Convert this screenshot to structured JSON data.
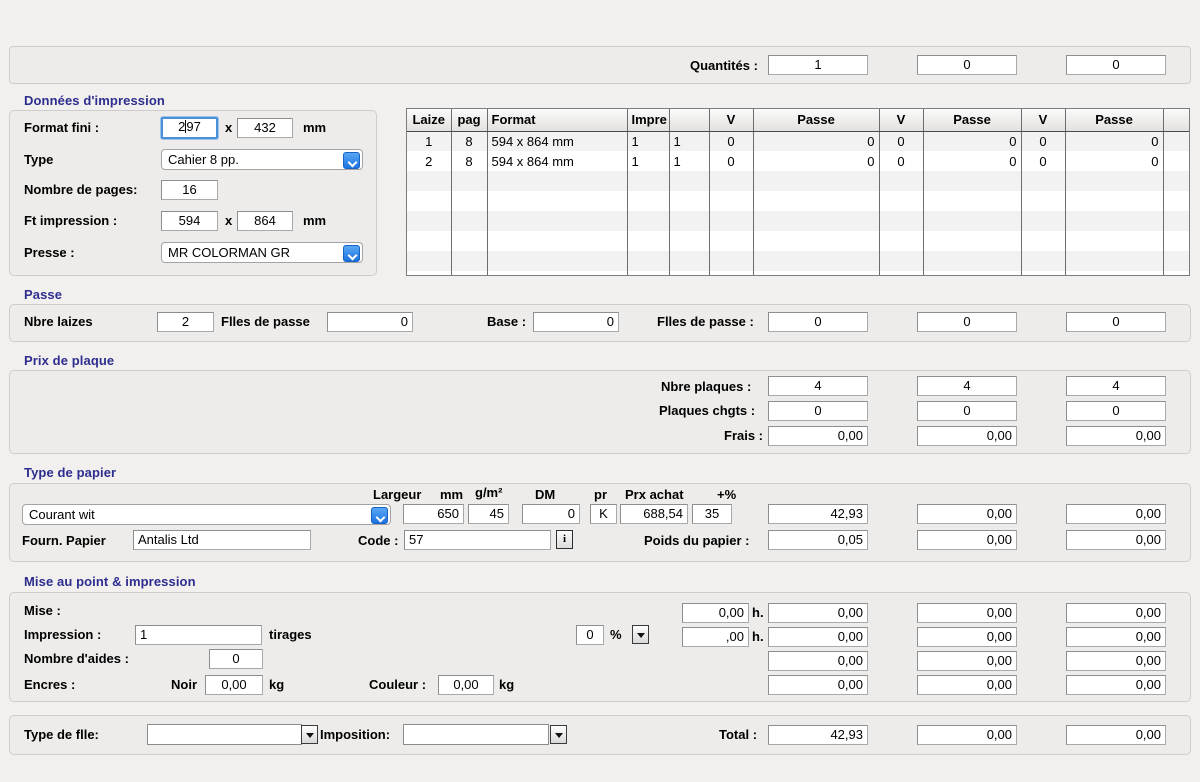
{
  "quantities": {
    "label": "Quantités :",
    "values": [
      "1",
      "0",
      "0"
    ]
  },
  "donnees": {
    "title": "Données d'impression",
    "format_fini_label": "Format fini :",
    "format_fini_w": "297",
    "format_fini_h": "432",
    "format_fini_unit": "mm",
    "type_label": "Type",
    "type_value": "Cahier   8 pp.",
    "nombre_pages_label": "Nombre de pages:",
    "nombre_pages_value": "16",
    "ft_impression_label": "Ft impression :",
    "ft_impression_w": "594",
    "ft_impression_h": "864",
    "ft_impression_unit": "mm",
    "presse_label": "Presse :",
    "presse_value": "MR COLORMAN GR",
    "x_separator": "x"
  },
  "table": {
    "headers": [
      "Laize",
      "pag",
      "Format",
      "Impre",
      "",
      "V",
      "Passe",
      "V",
      "Passe",
      "V",
      "Passe",
      ""
    ],
    "rows": [
      [
        "1",
        "8",
        "594 x 864 mm",
        "1",
        "1",
        "0",
        "0",
        "0",
        "0",
        "0",
        "0",
        ""
      ],
      [
        "2",
        "8",
        "594 x 864 mm",
        "1",
        "1",
        "0",
        "0",
        "0",
        "0",
        "0",
        "0",
        ""
      ]
    ],
    "empty_rows": 6
  },
  "passe": {
    "title": "Passe",
    "nbre_laizes_label": "Nbre laizes",
    "nbre_laizes_value": "2",
    "flles_de_passe_label": "Flles de passe",
    "flles_de_passe_value": "0",
    "base_label": "Base :",
    "base_value": "0",
    "flles_de_passe2_label": "Flles de passe :",
    "flles_de_passe2_values": [
      "0",
      "0",
      "0"
    ]
  },
  "plaque": {
    "title": "Prix de plaque",
    "nbre_plaques_label": "Nbre plaques :",
    "nbre_plaques_values": [
      "4",
      "4",
      "4"
    ],
    "plaques_chgts_label": "Plaques chgts :",
    "plaques_chgts_values": [
      "0",
      "0",
      "0"
    ],
    "frais_label": "Frais :",
    "frais_values": [
      "0,00",
      "0,00",
      "0,00"
    ]
  },
  "papier": {
    "title": "Type de papier",
    "col_largeur": "Largeur",
    "col_mm": "mm",
    "col_gm2": "g/m²",
    "col_dm": "DM",
    "col_pr": "pr",
    "col_prx_achat": "Prx achat",
    "col_pct": "+%",
    "type_value": "Courant wit",
    "largeur_value": "650",
    "gm2_value": "45",
    "dm_value": "0",
    "pr_value": "K",
    "prx_achat_value": "688,54",
    "pct_value": "35",
    "amount_values": [
      "42,93",
      "0,00",
      "0,00"
    ],
    "fourn_label": "Fourn. Papier",
    "fourn_value": "Antalis Ltd",
    "code_label": "Code :",
    "code_value": "57",
    "info_icon": "i",
    "poids_label": "Poids du papier :",
    "poids_values": [
      "0,05",
      "0,00",
      "0,00"
    ]
  },
  "mise": {
    "title": "Mise au point & impression",
    "mise_label": "Mise :",
    "impression_label": "Impression :",
    "impression_value": "1",
    "tirages_label": "tirages",
    "nombre_aides_label": "Nombre d'aides :",
    "nombre_aides_value": "0",
    "encres_label": "Encres :",
    "noir_label": "Noir",
    "noir_value": "0,00",
    "noir_unit": "kg",
    "couleur_label": "Couleur :",
    "couleur_value": "0,00",
    "couleur_unit": "kg",
    "pct_value": "0",
    "pct_sign": "%",
    "hours": [
      "0,00",
      ",00"
    ],
    "hours_unit": "h.",
    "grid": [
      [
        "0,00",
        "0,00",
        "0,00"
      ],
      [
        "0,00",
        "0,00",
        "0,00"
      ],
      [
        "0,00",
        "0,00",
        "0,00"
      ],
      [
        "0,00",
        "0,00",
        "0,00"
      ]
    ]
  },
  "footer": {
    "type_fille_label": "Type de flle:",
    "type_fille_value": "",
    "imposition_label": "Imposition:",
    "imposition_value": "",
    "total_label": "Total :",
    "total_values": [
      "42,93",
      "0,00",
      "0,00"
    ]
  }
}
